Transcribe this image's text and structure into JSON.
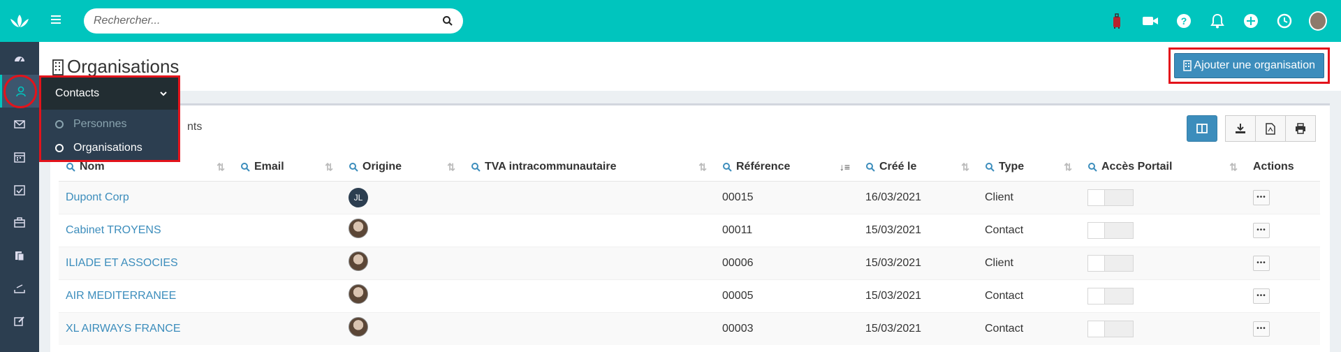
{
  "app": {
    "accent_color": "#00c5be",
    "sidebar_color": "#2c3e50"
  },
  "topbar": {
    "search_placeholder": "Rechercher...",
    "icons": [
      "luggage-icon",
      "video-icon",
      "help-icon",
      "bell-icon",
      "plus-icon",
      "clock-icon",
      "user-avatar"
    ]
  },
  "sidebar": {
    "items": [
      {
        "name": "dashboard-icon"
      },
      {
        "name": "contacts-icon",
        "active": true
      },
      {
        "name": "mail-icon"
      },
      {
        "name": "calendar-icon"
      },
      {
        "name": "tasks-icon"
      },
      {
        "name": "briefcase-icon"
      },
      {
        "name": "documents-icon"
      },
      {
        "name": "tray-icon"
      },
      {
        "name": "edit-icon"
      }
    ]
  },
  "contacts_menu": {
    "title": "Contacts",
    "items": [
      {
        "label": "Personnes",
        "active": false
      },
      {
        "label": "Organisations",
        "active": true
      }
    ]
  },
  "page": {
    "title": "Organisations",
    "add_button_label": "Ajouter une organisation",
    "entries_text": "nts"
  },
  "table": {
    "columns": [
      "Nom",
      "Email",
      "Origine",
      "TVA intracommunautaire",
      "Référence",
      "Créé le",
      "Type",
      "Accès Portail",
      "Actions"
    ],
    "rows": [
      {
        "nom": "Dupont Corp",
        "email": "",
        "origine": "JL",
        "origine_type": "initials",
        "tva": "",
        "reference": "00015",
        "cree_le": "16/03/2021",
        "type": "Client",
        "acces_portail": false
      },
      {
        "nom": "Cabinet TROYENS",
        "email": "",
        "origine": "",
        "origine_type": "photo",
        "tva": "",
        "reference": "00011",
        "cree_le": "15/03/2021",
        "type": "Contact",
        "acces_portail": false
      },
      {
        "nom": "ILIADE ET ASSOCIES",
        "email": "",
        "origine": "",
        "origine_type": "photo",
        "tva": "",
        "reference": "00006",
        "cree_le": "15/03/2021",
        "type": "Client",
        "acces_portail": false
      },
      {
        "nom": "AIR MEDITERRANEE",
        "email": "",
        "origine": "",
        "origine_type": "photo",
        "tva": "",
        "reference": "00005",
        "cree_le": "15/03/2021",
        "type": "Contact",
        "acces_portail": false
      },
      {
        "nom": "XL AIRWAYS FRANCE",
        "email": "",
        "origine": "",
        "origine_type": "photo",
        "tva": "",
        "reference": "00003",
        "cree_le": "15/03/2021",
        "type": "Contact",
        "acces_portail": false
      }
    ]
  }
}
